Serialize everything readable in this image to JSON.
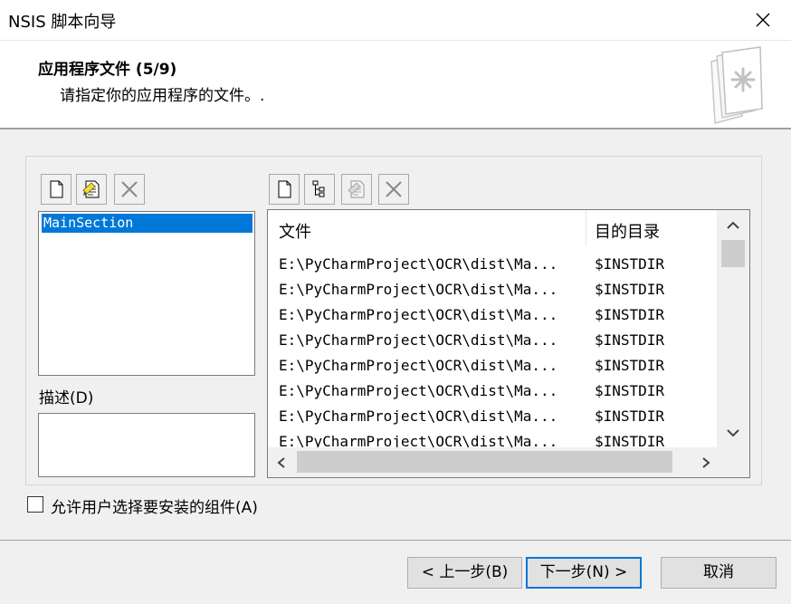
{
  "window": {
    "title": "NSIS 脚本向导"
  },
  "header": {
    "step_title": "应用程序文件 (5/9)",
    "step_description": "请指定你的应用程序的文件。.",
    "icon": "wizard-page-icon"
  },
  "sections": {
    "toolbar_icons": [
      "new-section-icon",
      "edit-section-icon",
      "delete-section-icon"
    ],
    "items": [
      "MainSection"
    ],
    "description_label": "描述(D)",
    "description_value": ""
  },
  "files": {
    "toolbar_icons": [
      "add-file-icon",
      "add-directory-icon",
      "edit-file-icon",
      "delete-file-icon"
    ],
    "columns": {
      "file": "文件",
      "dest": "目的目录"
    },
    "rows": [
      {
        "file": "E:\\PyCharmProject\\OCR\\dist\\Ma...",
        "dest": "$INSTDIR"
      },
      {
        "file": "E:\\PyCharmProject\\OCR\\dist\\Ma...",
        "dest": "$INSTDIR"
      },
      {
        "file": "E:\\PyCharmProject\\OCR\\dist\\Ma...",
        "dest": "$INSTDIR"
      },
      {
        "file": "E:\\PyCharmProject\\OCR\\dist\\Ma...",
        "dest": "$INSTDIR"
      },
      {
        "file": "E:\\PyCharmProject\\OCR\\dist\\Ma...",
        "dest": "$INSTDIR"
      },
      {
        "file": "E:\\PyCharmProject\\OCR\\dist\\Ma...",
        "dest": "$INSTDIR"
      },
      {
        "file": "E:\\PyCharmProject\\OCR\\dist\\Ma...",
        "dest": "$INSTDIR"
      },
      {
        "file": "E:\\PyCharmProject\\OCR\\dist\\Ma...",
        "dest": "$INSTDIR"
      }
    ]
  },
  "options": {
    "allow_choose_components_label": "允许用户选择要安装的组件(A)",
    "allow_choose_components_checked": false
  },
  "buttons": {
    "back": "< 上一步(B)",
    "next": "下一步(N) >",
    "cancel": "取消"
  },
  "colors": {
    "selection": "#0078d7",
    "focus_border": "#0078d7"
  }
}
